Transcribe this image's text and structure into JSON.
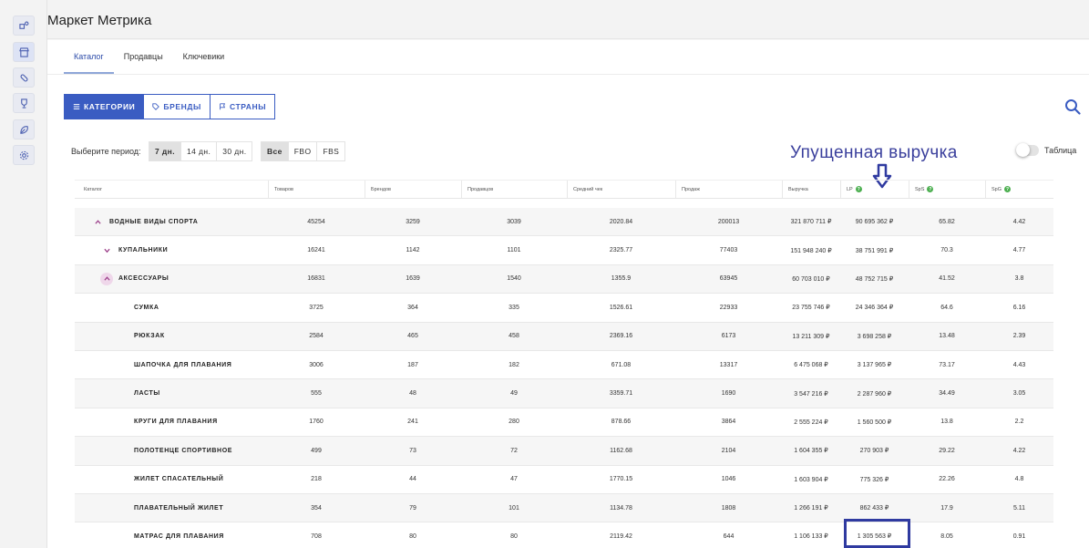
{
  "app": {
    "title": "Маркет Метрика"
  },
  "sidebar": {
    "icons": [
      "puzzle-icon",
      "store-icon",
      "pill-icon",
      "trophy-icon",
      "leaf-icon",
      "settings-icon"
    ]
  },
  "tabs": [
    {
      "label": "Каталог",
      "active": true
    },
    {
      "label": "Продавцы",
      "active": false
    },
    {
      "label": "Ключевики",
      "active": false
    }
  ],
  "segment": [
    {
      "label": "КАТЕГОРИИ",
      "icon": "list-icon",
      "active": true
    },
    {
      "label": "БРЕНДЫ",
      "icon": "tag-icon",
      "active": false
    },
    {
      "label": "СТРАНЫ",
      "icon": "flag-icon",
      "active": false
    }
  ],
  "period": {
    "label": "Выберите период:",
    "options": [
      {
        "label": "7 дн.",
        "active": true
      },
      {
        "label": "14 дн.",
        "active": false
      },
      {
        "label": "30 дн.",
        "active": false
      }
    ]
  },
  "fulfillment": {
    "options": [
      {
        "label": "Все",
        "active": true
      },
      {
        "label": "FBO",
        "active": false
      },
      {
        "label": "FBS",
        "active": false
      }
    ]
  },
  "annotation": {
    "text": "Упущенная выручка"
  },
  "toggle": {
    "label": "Таблица",
    "on": false
  },
  "table": {
    "headers": [
      {
        "label": "Каталог",
        "help": false
      },
      {
        "label": "Товаров",
        "help": false
      },
      {
        "label": "Брендов",
        "help": false
      },
      {
        "label": "Продавцов",
        "help": false
      },
      {
        "label": "Средний чек",
        "help": false
      },
      {
        "label": "Продаж",
        "help": false
      },
      {
        "label": "Выручка",
        "help": false
      },
      {
        "label": "LP",
        "help": true
      },
      {
        "label": "SpS",
        "help": true
      },
      {
        "label": "SpG",
        "help": true
      }
    ],
    "rows": [
      {
        "level": 0,
        "chevron": "up",
        "name": "ВОДНЫЕ ВИДЫ СПОРТА",
        "cells": [
          "45254",
          "3259",
          "3039",
          "2020.84",
          "200013",
          "321 870 711 ₽",
          "90 695 362 ₽",
          "65.82",
          "4.42"
        ]
      },
      {
        "level": 1,
        "chevron": "down",
        "name": "КУПАЛЬНИКИ",
        "cells": [
          "16241",
          "1142",
          "1101",
          "2325.77",
          "77403",
          "151 948 240 ₽",
          "38 751 991 ₽",
          "70.3",
          "4.77"
        ]
      },
      {
        "level": 1,
        "chevron": "up",
        "name": "АКСЕССУАРЫ",
        "cells": [
          "16831",
          "1639",
          "1540",
          "1355.9",
          "63945",
          "60 703 010 ₽",
          "48 752 715 ₽",
          "41.52",
          "3.8"
        ]
      },
      {
        "level": 2,
        "chevron": "",
        "name": "СУМКА",
        "cells": [
          "3725",
          "364",
          "335",
          "1526.61",
          "22933",
          "23 755 746 ₽",
          "24 346 364 ₽",
          "64.6",
          "6.16"
        ]
      },
      {
        "level": 2,
        "chevron": "",
        "name": "РЮКЗАК",
        "cells": [
          "2584",
          "465",
          "458",
          "2369.16",
          "6173",
          "13 211 309 ₽",
          "3 698 258 ₽",
          "13.48",
          "2.39"
        ]
      },
      {
        "level": 2,
        "chevron": "",
        "name": "ШАПОЧКА ДЛЯ ПЛАВАНИЯ",
        "cells": [
          "3006",
          "187",
          "182",
          "671.08",
          "13317",
          "6 475 068 ₽",
          "3 137 965 ₽",
          "73.17",
          "4.43"
        ]
      },
      {
        "level": 2,
        "chevron": "",
        "name": "ЛАСТЫ",
        "cells": [
          "555",
          "48",
          "49",
          "3359.71",
          "1690",
          "3 547 216 ₽",
          "2 287 960 ₽",
          "34.49",
          "3.05"
        ]
      },
      {
        "level": 2,
        "chevron": "",
        "name": "КРУГИ ДЛЯ ПЛАВАНИЯ",
        "cells": [
          "1760",
          "241",
          "280",
          "878.66",
          "3864",
          "2 555 224 ₽",
          "1 560 500 ₽",
          "13.8",
          "2.2"
        ]
      },
      {
        "level": 2,
        "chevron": "",
        "name": "ПОЛОТЕНЦЕ СПОРТИВНОЕ",
        "cells": [
          "499",
          "73",
          "72",
          "1162.68",
          "2104",
          "1 604 355 ₽",
          "270 903 ₽",
          "29.22",
          "4.22"
        ]
      },
      {
        "level": 2,
        "chevron": "",
        "name": "ЖИЛЕТ СПАСАТЕЛЬНЫЙ",
        "cells": [
          "218",
          "44",
          "47",
          "1770.15",
          "1046",
          "1 603 904 ₽",
          "775 326 ₽",
          "22.26",
          "4.8"
        ]
      },
      {
        "level": 2,
        "chevron": "",
        "name": "ПЛАВАТЕЛЬНЫЙ ЖИЛЕТ",
        "cells": [
          "354",
          "79",
          "101",
          "1134.78",
          "1808",
          "1 266 191 ₽",
          "862 433 ₽",
          "17.9",
          "5.11"
        ]
      },
      {
        "level": 2,
        "chevron": "",
        "name": "МАТРАС ДЛЯ ПЛАВАНИЯ",
        "cells": [
          "708",
          "80",
          "80",
          "2119.42",
          "644",
          "1 106 133 ₽",
          "1 305 563 ₽",
          "8.05",
          "0.91"
        ]
      }
    ]
  },
  "colors": {
    "accent": "#3a5cc2",
    "annotation": "#3a3f9c",
    "highlight": "#2f3aa0",
    "help": "#4caf50",
    "row_alt": "#f6f6f6"
  }
}
